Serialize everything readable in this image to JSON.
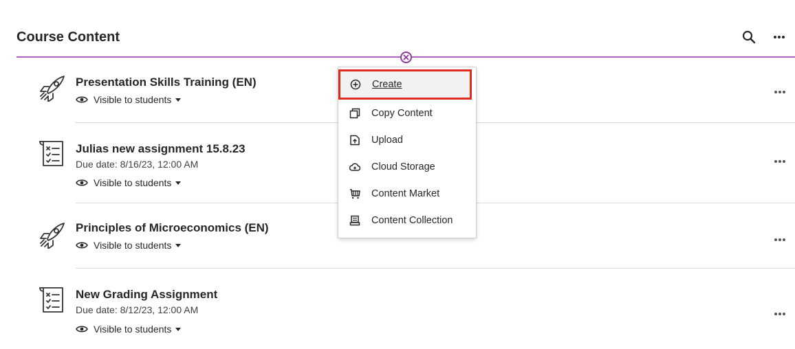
{
  "header": {
    "title": "Course Content",
    "search_icon": "search-icon",
    "more_icon": "more-options-icon"
  },
  "add_button": {
    "icon": "add-circle-icon",
    "color": "#8c3a9b",
    "line_color": "#b35ec5"
  },
  "items": [
    {
      "title": "Presentation Skills Training (EN)",
      "icon": "rocket-icon",
      "due": "",
      "visibility": "Visible to students"
    },
    {
      "title": "Julias new assignment 15.8.23",
      "icon": "assignment-icon",
      "due": "Due date: 8/16/23, 12:00 AM",
      "visibility": "Visible to students"
    },
    {
      "title": "Principles of Microeconomics (EN)",
      "icon": "rocket-icon",
      "due": "",
      "visibility": "Visible to students"
    },
    {
      "title": "New Grading Assignment",
      "icon": "assignment-icon",
      "due": "Due date: 8/12/23, 12:00 AM",
      "visibility": "Visible to students"
    }
  ],
  "menu": {
    "items": [
      {
        "label": "Create",
        "icon": "plus-circle-icon",
        "active": true
      },
      {
        "label": "Copy Content",
        "icon": "copy-icon"
      },
      {
        "label": "Upload",
        "icon": "upload-icon"
      },
      {
        "label": "Cloud Storage",
        "icon": "cloud-icon"
      },
      {
        "label": "Content Market",
        "icon": "cart-icon"
      },
      {
        "label": "Content Collection",
        "icon": "collection-icon"
      }
    ],
    "highlight_color": "#e0291f"
  }
}
